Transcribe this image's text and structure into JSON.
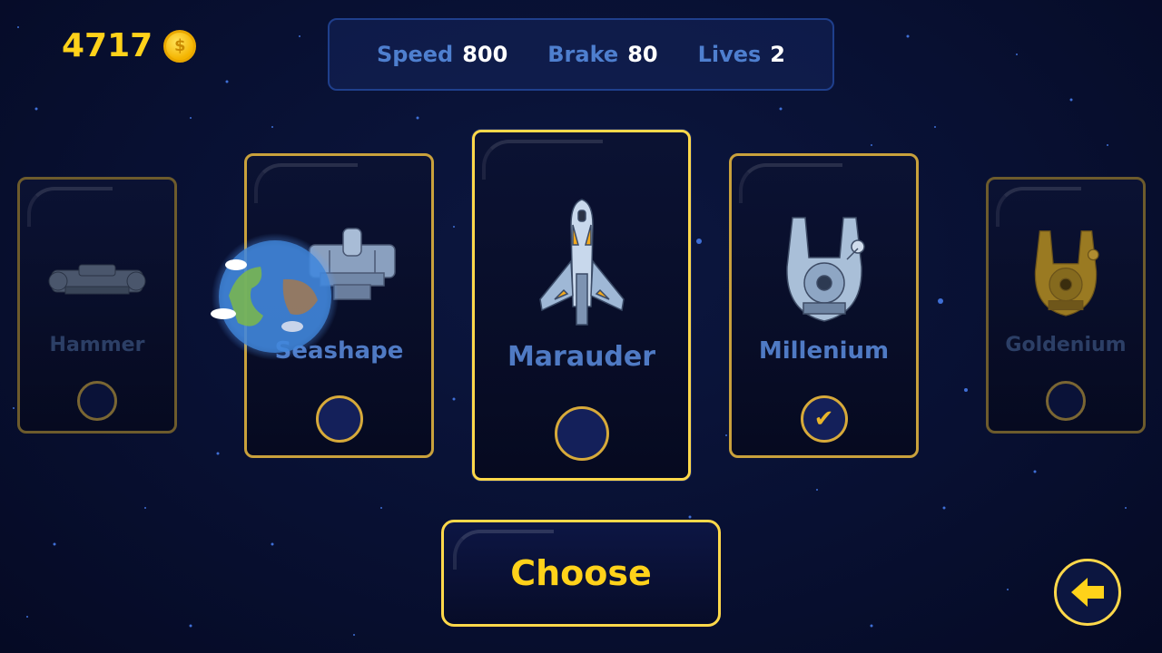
{
  "hud": {
    "coins": "4717",
    "coin_icon": "coin-icon"
  },
  "stats": {
    "speed_label": "Speed",
    "speed_value": "800",
    "brake_label": "Brake",
    "brake_value": "80",
    "lives_label": "Lives",
    "lives_value": "2"
  },
  "ships": [
    {
      "name": "Hammer",
      "selected": false
    },
    {
      "name": "Seashape",
      "selected": false
    },
    {
      "name": "Marauder",
      "selected": false
    },
    {
      "name": "Millenium",
      "selected": true
    },
    {
      "name": "Goldenium",
      "selected": false
    }
  ],
  "actions": {
    "choose_label": "Choose",
    "back_icon": "back-arrow-icon"
  },
  "colors": {
    "accent": "#ffd21a",
    "card_border": "#c9a13c",
    "label_blue": "#4f7ac4",
    "background": "#081032"
  }
}
